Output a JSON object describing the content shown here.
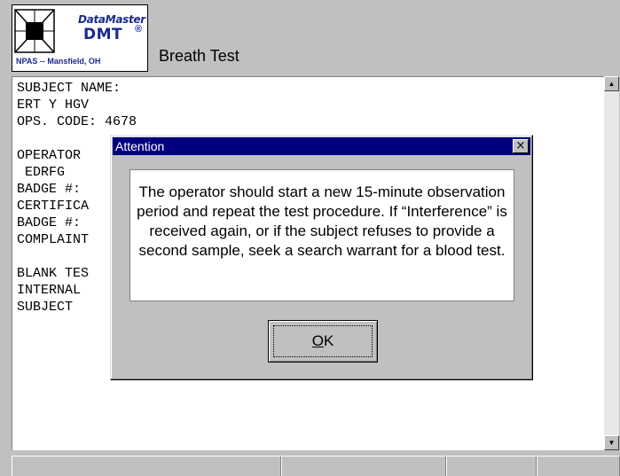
{
  "header": {
    "brand_name": "DataMaster",
    "brand_model": "DMT",
    "brand_reg": "®",
    "brand_location": "NPAS -- Mansfield, OH",
    "title": "Breath Test"
  },
  "record": {
    "lines": "SUBJECT NAME:\nERT Y HGV\nOPS. CODE: 4678\n\nOPERATOR\n EDRFG\nBADGE #:\nCERTIFICA\nBADGE #:\nCOMPLAINT\n\nBLANK TES\nINTERNAL\nSUBJECT"
  },
  "dialog": {
    "title": "Attention",
    "close_glyph": "×",
    "message": "The operator should start a new 15-minute observation period and repeat the test procedure.  If “Interference” is received again, or if the subject refuses to provide a second sample, seek a search warrant for a blood test.",
    "ok_mnemonic": "O",
    "ok_rest": "K"
  },
  "scrollbar": {
    "up_glyph": "▲",
    "down_glyph": "▼"
  },
  "colors": {
    "titlebar": "#000080",
    "brand": "#1a2a8a",
    "window_bg": "#c0c0c0"
  }
}
